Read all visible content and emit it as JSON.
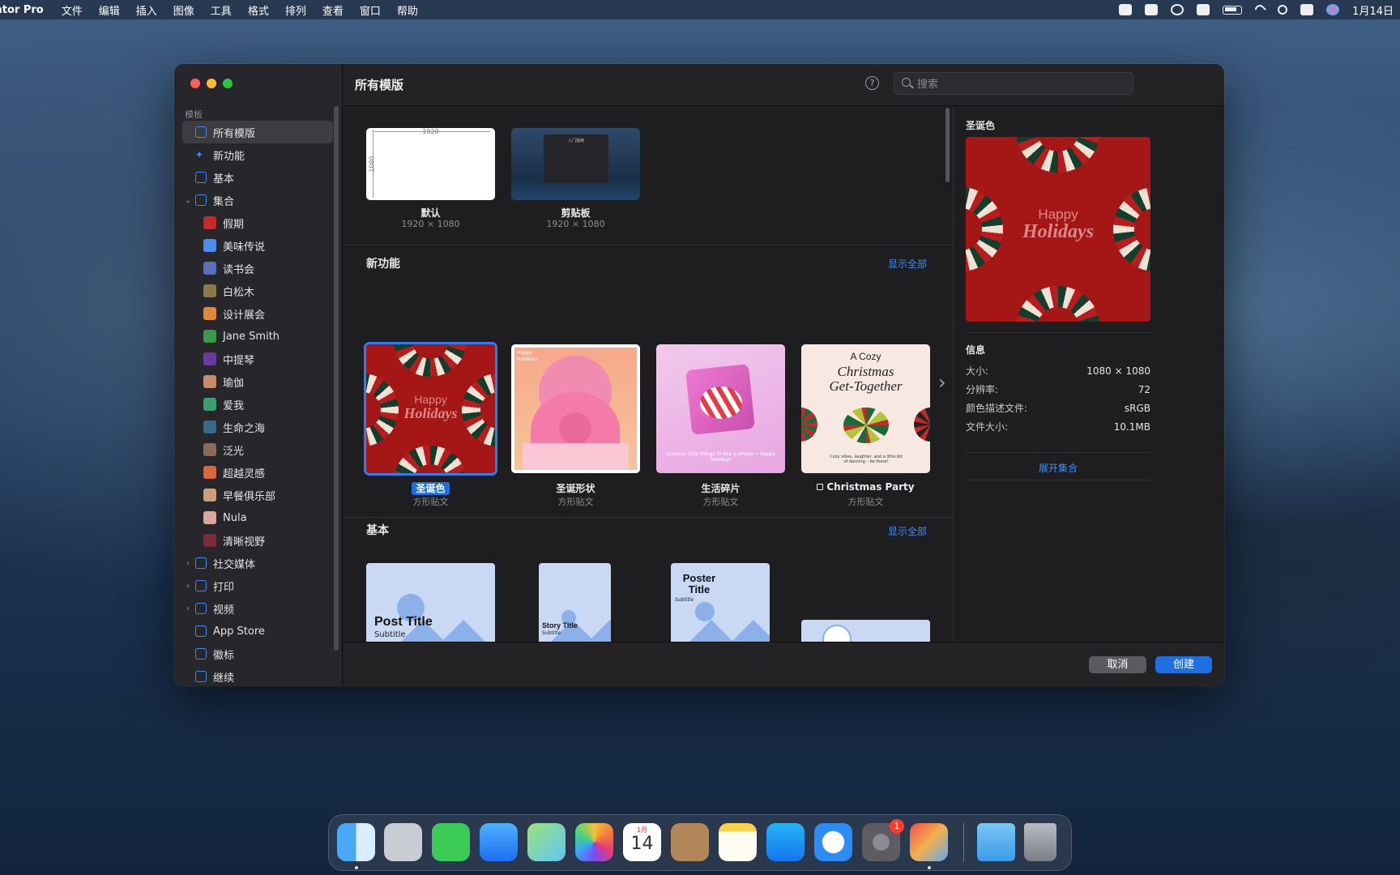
{
  "menubar": {
    "app_name": "ator Pro",
    "menus": [
      "文件",
      "编辑",
      "插入",
      "图像",
      "工具",
      "格式",
      "排列",
      "查看",
      "窗口",
      "帮助"
    ],
    "clock": "1月14日"
  },
  "sidebar": {
    "section_label": "模板",
    "items": [
      {
        "label": "所有模版",
        "icon": "grid-icon",
        "selected": true
      },
      {
        "label": "新功能",
        "icon": "sparkle-icon"
      },
      {
        "label": "基本",
        "icon": "rectangle-icon"
      },
      {
        "label": "集合",
        "icon": "collection-icon",
        "expanded": true
      }
    ],
    "collection_items": [
      {
        "label": "假期",
        "color": "#c42a2a"
      },
      {
        "label": "美味传说",
        "color": "#4b8cf0"
      },
      {
        "label": "读书会",
        "color": "#5a6fb5"
      },
      {
        "label": "白松木",
        "color": "#8a7a4a"
      },
      {
        "label": "设计展会",
        "color": "#e0893a"
      },
      {
        "label": "Jane Smith",
        "color": "#3a9a4a"
      },
      {
        "label": "中提琴",
        "color": "#6a3aa0"
      },
      {
        "label": "瑜伽",
        "color": "#c98a6a"
      },
      {
        "label": "爱我",
        "color": "#3aa06a"
      },
      {
        "label": "生命之海",
        "color": "#3a6a8a"
      },
      {
        "label": "泛光",
        "color": "#8a6a5a"
      },
      {
        "label": "超越灵感",
        "color": "#d86a3a"
      },
      {
        "label": "早餐俱乐部",
        "color": "#caa07a"
      },
      {
        "label": "Nula",
        "color": "#d8a8a0"
      },
      {
        "label": "清晰视野",
        "color": "#7a2a3a"
      }
    ],
    "bottom_items": [
      {
        "label": "社交媒体",
        "icon": "at-icon",
        "chevron": true
      },
      {
        "label": "打印",
        "icon": "printer-icon",
        "chevron": true
      },
      {
        "label": "视频",
        "icon": "video-icon",
        "chevron": true
      },
      {
        "label": "App Store",
        "icon": "appstore-icon"
      },
      {
        "label": "徽标",
        "icon": "logo-icon"
      },
      {
        "label": "继续",
        "icon": "document-icon"
      }
    ]
  },
  "toolbar": {
    "title": "所有模版",
    "help": "?",
    "search_placeholder": "搜索"
  },
  "top_cards": [
    {
      "name": "默认",
      "size": "1920 × 1080",
      "w_label": "1920",
      "h_label": "1080"
    },
    {
      "name": "剪贴板",
      "size": "1920 × 1080",
      "inner_title": "入门指南"
    }
  ],
  "sections": {
    "new": {
      "title": "新功能",
      "show_all": "显示全部"
    },
    "basic": {
      "title": "基本",
      "show_all": "显示全部"
    }
  },
  "new_cards": [
    {
      "name": "圣诞色",
      "sub": "方形贴文",
      "selected": true,
      "text1": "Happy",
      "text2": "Holidays"
    },
    {
      "name": "圣诞形状",
      "sub": "方形贴文",
      "text1": "Happy",
      "text2": "Holidays"
    },
    {
      "name": "生活碎片",
      "sub": "方形贴文",
      "text": "Uncover little things to live a simple • Happy Holidays"
    },
    {
      "name": "Christmas Party",
      "sub": "方形贴文",
      "line1": "A Cozy",
      "line2": "Christmas",
      "line3": "Get-Together",
      "footnote": "Cozy vibes, laughter, and a little bit of dancing – be there!"
    }
  ],
  "basic_cards": [
    {
      "title": "Post Title",
      "subtitle": "Subtitle"
    },
    {
      "title": "Story Title",
      "subtitle": "Subtitle"
    },
    {
      "title": "Poster Title",
      "subtitle": "Subtitle"
    },
    {
      "title": "",
      "subtitle": ""
    }
  ],
  "inspector": {
    "title": "圣诞色",
    "info_header": "信息",
    "rows": [
      {
        "k": "大小:",
        "v": "1080 × 1080"
      },
      {
        "k": "分辨率:",
        "v": "72"
      },
      {
        "k": "颜色描述文件:",
        "v": "sRGB"
      },
      {
        "k": "文件大小:",
        "v": "10.1MB"
      }
    ],
    "expand": "展开集合"
  },
  "footer": {
    "cancel": "取消",
    "create": "创建"
  },
  "dock": {
    "apps": [
      "finder-icon",
      "launchpad-icon",
      "messages-icon",
      "mail-icon",
      "maps-icon",
      "photos-icon",
      "calendar-icon",
      "contacts-icon",
      "notes-icon",
      "appstore-icon",
      "safari-icon",
      "settings-icon",
      "pixelmator-icon",
      "downloads-icon",
      "trash-icon"
    ],
    "calendar_month": "1月",
    "calendar_day": "14",
    "settings_badge": "1"
  }
}
